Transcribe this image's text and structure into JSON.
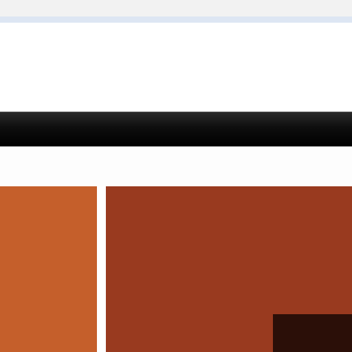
{
  "colors": {
    "header_background": "#f2f2f2",
    "header_accent_line": "#dde6f3",
    "content_background": "#ffffff",
    "nav_bar": "#000000",
    "tile_left": "#c55f2b",
    "tile_right": "#993a1f",
    "tile_inner_dark": "#2b0f08"
  }
}
